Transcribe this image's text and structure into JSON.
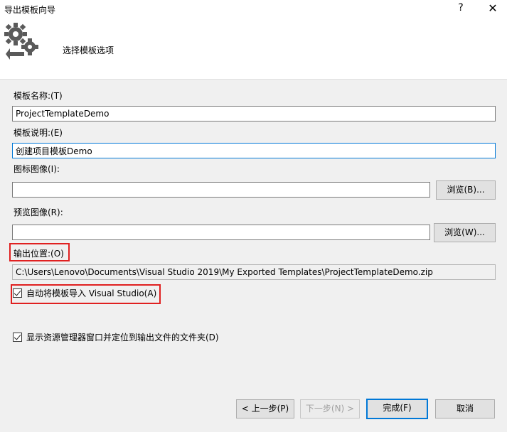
{
  "window": {
    "title": "导出模板向导",
    "help_label": "?",
    "close_label": "✕"
  },
  "header": {
    "title": "选择模板选项",
    "icon": "gear-export-icon"
  },
  "form": {
    "name_label": "模板名称:(T)",
    "name_value": "ProjectTemplateDemo",
    "desc_label": "模板说明:(E)",
    "desc_value": "创建项目模板Demo",
    "icon_label": "图标图像(I):",
    "icon_value": "",
    "icon_browse": "浏览(B)...",
    "preview_label": "预览图像(R):",
    "preview_value": "",
    "preview_browse": "浏览(W)...",
    "output_label": "输出位置:(O)",
    "output_value": "C:\\Users\\Lenovo\\Documents\\Visual Studio 2019\\My Exported Templates\\ProjectTemplateDemo.zip",
    "auto_import_label": "自动将模板导入 Visual Studio(A)",
    "auto_import_checked": true,
    "show_explorer_label": "显示资源管理器窗口并定位到输出文件的文件夹(D)",
    "show_explorer_checked": true
  },
  "footer": {
    "prev_label": "< 上一步(P)",
    "next_label": "下一步(N) >",
    "finish_label": "完成(F)",
    "cancel_label": "取消"
  },
  "colors": {
    "highlight": "#e02020",
    "accent": "#0078d7"
  }
}
